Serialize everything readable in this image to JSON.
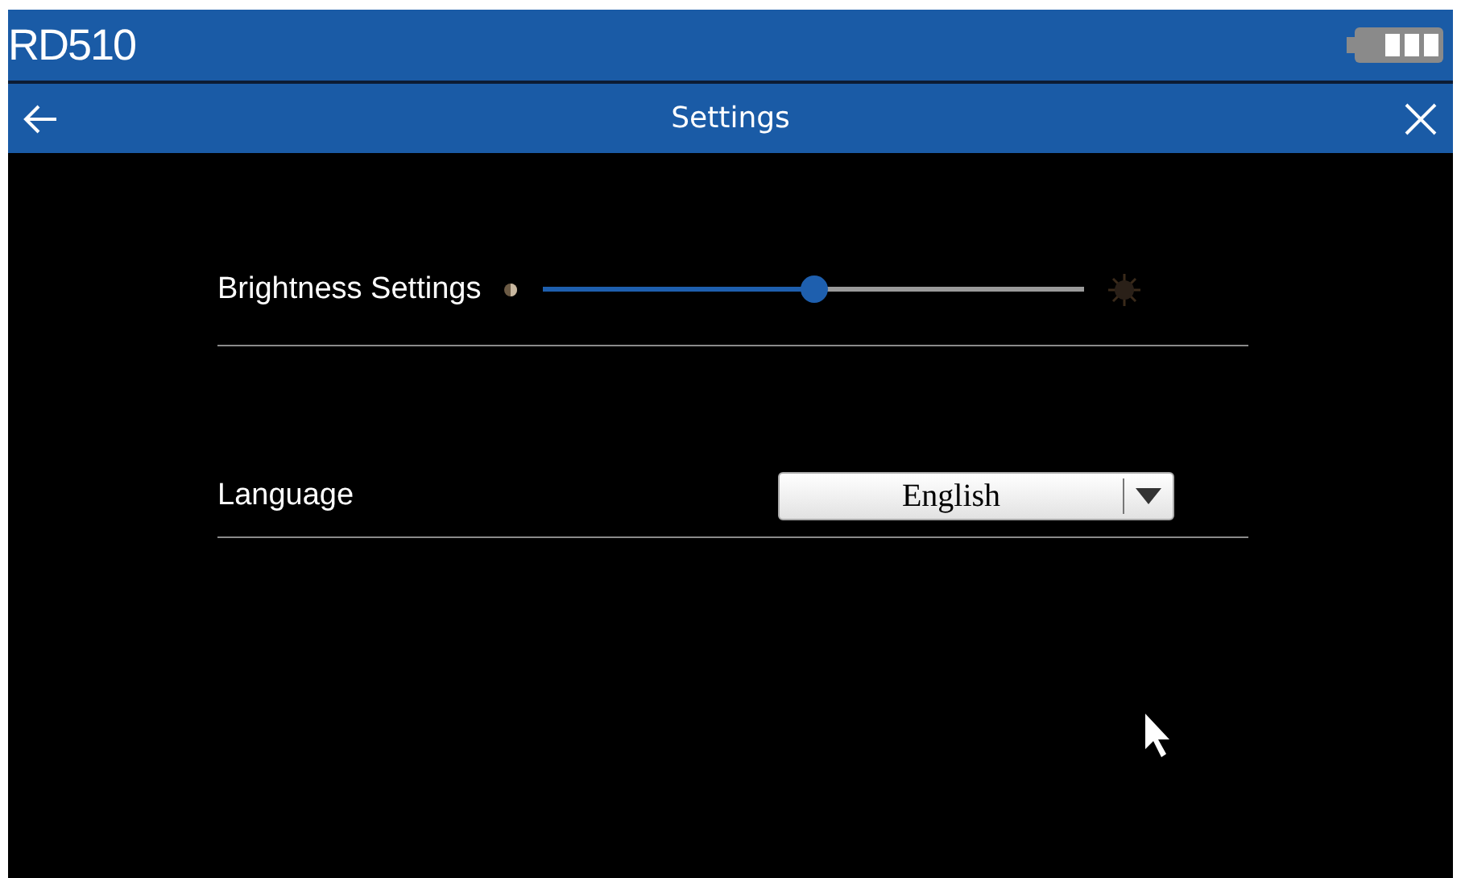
{
  "device": {
    "name": "RD510"
  },
  "header": {
    "title": "Settings"
  },
  "brightness": {
    "label": "Brightness Settings",
    "level": 0.5
  },
  "language": {
    "label": "Language",
    "value": "English"
  }
}
